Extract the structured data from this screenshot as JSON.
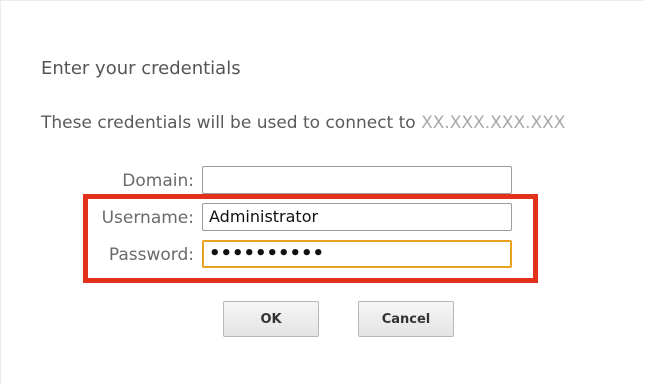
{
  "dialog": {
    "title": "Enter your credentials",
    "description_prefix": "These credentials will be used to connect to ",
    "host": "XX.XXX.XXX.XXX"
  },
  "form": {
    "domain_label": "Domain:",
    "domain_value": "",
    "username_label": "Username:",
    "username_value": "Administrator",
    "password_label": "Password:",
    "password_masked": "••••••••••"
  },
  "buttons": {
    "ok_label": "OK",
    "cancel_label": "Cancel"
  },
  "colors": {
    "highlight": "#e3321b",
    "focus_border": "#e8a21f"
  }
}
